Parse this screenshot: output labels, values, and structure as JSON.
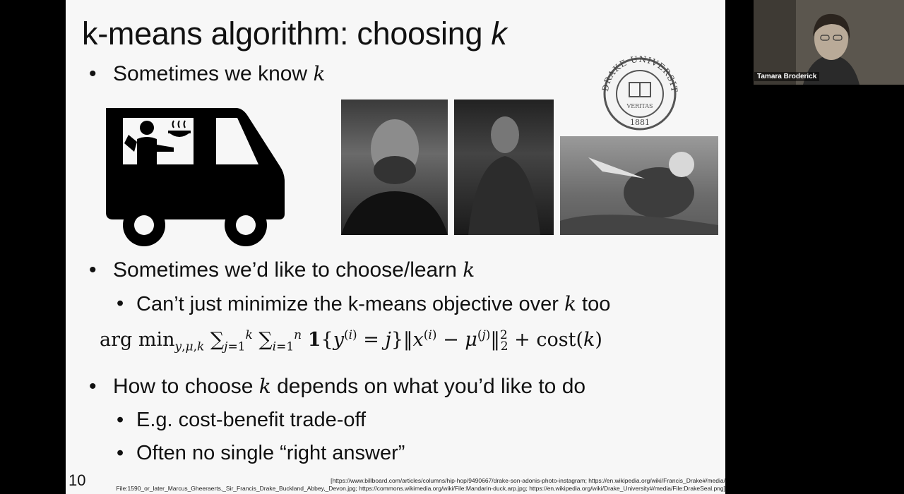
{
  "slide": {
    "title_prefix": "k-means algorithm: choosing ",
    "title_var": "k",
    "bullets": [
      {
        "text": "Sometimes we know ",
        "var": "k"
      },
      {
        "text": "Sometimes we’d like to choose/learn ",
        "var": "k"
      },
      {
        "text": "How to choose ",
        "var": "k",
        "tail": " depends on what you’d like to do"
      }
    ],
    "subbullets": [
      {
        "text": "Can’t just minimize the k-means objective over ",
        "var": "k",
        "tail": " too"
      },
      {
        "text": "E.g. cost-benefit trade-off"
      },
      {
        "text": "Often no single “right answer”"
      }
    ],
    "slide_number": "10",
    "references_line1": "[https://www.billboard.com/articles/columns/hip-hop/9490667/drake-son-adonis-photo-instagram; https://en.wikipedia.org/wiki/Francis_Drake#/media/",
    "references_line2": "File:1590_or_later_Marcus_Gheeraerts,_Sir_Francis_Drake_Buckland_Abbey,_Devon.jpg; https://commons.wikimedia.org/wiki/File:Mandarin-duck.arp.jpg; https://en.wikipedia.org/wiki/Drake_University#/media/File:DrakeSeal.png]",
    "seal": {
      "top_text": "DRAKE UNIVERSITY",
      "center_text": "VERITAS",
      "year": "1881"
    }
  },
  "webcam": {
    "participant_name": "Tamara Broderick"
  },
  "icons": [
    "food-truck-icon",
    "drake-university-seal"
  ],
  "colors": {
    "slide_bg": "#f7f7f7",
    "frame_bg": "#000000",
    "text": "#111111"
  }
}
